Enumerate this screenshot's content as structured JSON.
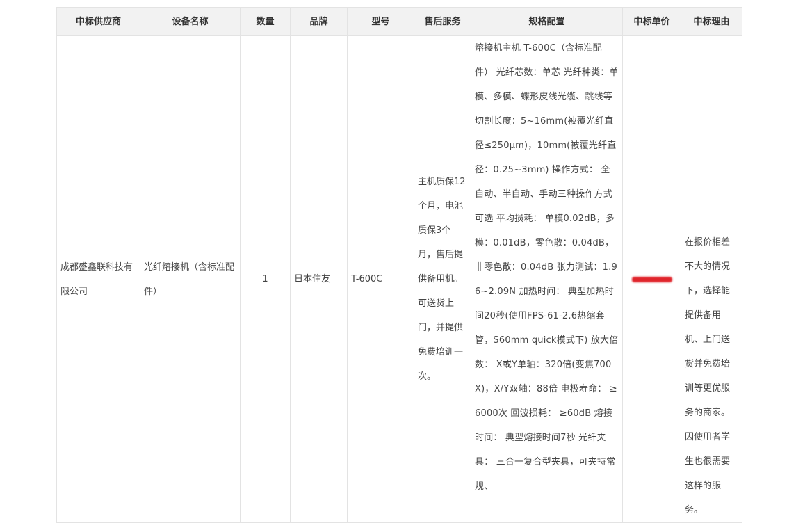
{
  "table": {
    "headers": [
      "中标供应商",
      "设备名称",
      "数量",
      "品牌",
      "型号",
      "售后服务",
      "规格配置",
      "中标单价",
      "中标理由"
    ],
    "row": {
      "supplier": "成都盛鑫联科技有限公司",
      "device": "光纤熔接机（含标准配件）",
      "quantity": "1",
      "brand": "日本住友",
      "model": "T-600C",
      "service": "主机质保12个月，电池质保3个月，售后提供备用机。可送货上门，并提供免费培训一次。",
      "spec": "熔接机主机 T-600C（含标准配件） 光纤芯数：单芯 光纤种类：单模、多模、蝶形皮线光缆、跳线等 切割长度：5~16mm(被覆光纤直径≤250μm)，10mm(被覆光纤直径：0.25~3mm) 操作方式： 全自动、半自动、手动三种操作方式可选 平均损耗： 单模0.02dB，多模：0.01dB，零色散：0.04dB，非零色散：0.04dB 张力测试：1.96~2.09N 加热时间： 典型加热时间20秒(使用FPS-61-2.6热缩套管，S60mm quick模式下) 放大倍数： X或Y单轴：320倍(变焦700X)，X/Y双轴：88倍 电极寿命： ≥6000次 回波损耗： ≥60dB 熔接时间： 典型熔接时间7秒 光纤夹具： 三合一复合型夹具，可夹持常规、",
      "unit_price_mask_color": "#e0242b",
      "reason": "在报价相差不大的情况下，选择能提供备用机、上门送货并免费培训等更优服务的商家。因使用者学生也很需要这样的服务。"
    }
  }
}
